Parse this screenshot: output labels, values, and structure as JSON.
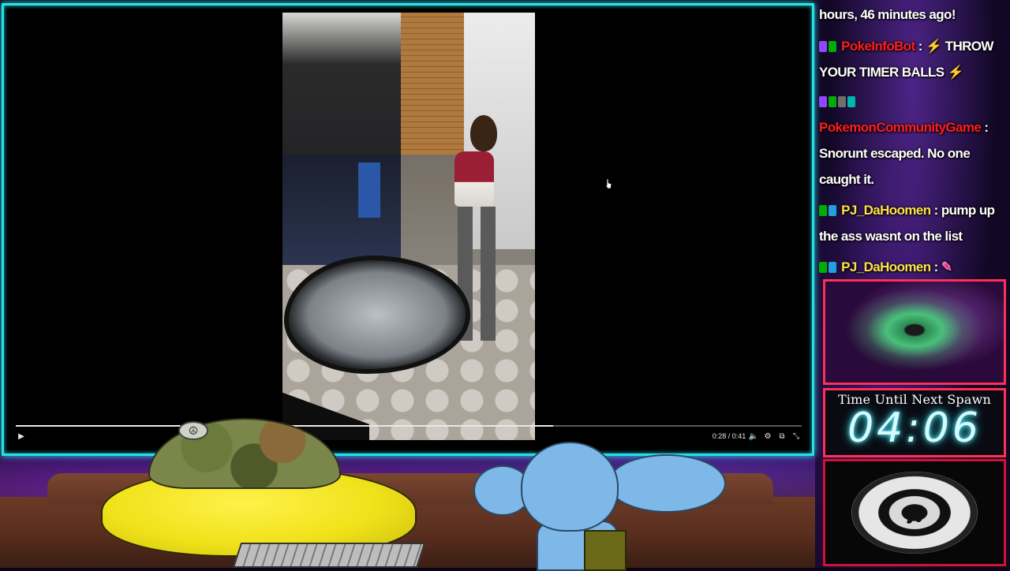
{
  "video": {
    "elapsed": "0:28",
    "duration": "0:41",
    "time_display": "0:28 / 0:41",
    "progress": 0.6833,
    "icons": {
      "play": "play-icon",
      "volume": "volume-icon",
      "settings": "settings-icon",
      "pip": "picture-in-picture-icon",
      "fullscreen": "fullscreen-exit-icon"
    }
  },
  "chat": {
    "messages": [
      {
        "badges": [],
        "user": "",
        "text": "hours, 46 minutes ago!"
      },
      {
        "badges": [
          "purple",
          "green"
        ],
        "user": "PokeInfoBot",
        "user_color": "#ff1e1e",
        "text": "THROW YOUR TIMER BALLS",
        "emoji": "lightning-emoji"
      },
      {
        "badges": [
          "purple",
          "green",
          "grey",
          "teal"
        ],
        "user": "PokemonCommunityGame",
        "user_color": "#ff1e1e",
        "text": "Snorunt escaped. No one caught it."
      },
      {
        "badges": [
          "green",
          "mod"
        ],
        "user": "PJ_DaHoomen",
        "user_color": "#ffe24a",
        "text": "pump up the ass wasnt on the list"
      },
      {
        "badges": [
          "green",
          "mod"
        ],
        "user": "PJ_DaHoomen",
        "user_color": "#ffe24a",
        "text": ""
      }
    ]
  },
  "spawn_timer": {
    "label": "Time Until Next Spawn",
    "value": "04:06"
  },
  "colors": {
    "frame_accent": "#27e1ea",
    "panel_border": "#ff2f55",
    "timer_glow": "#62f4ff"
  }
}
